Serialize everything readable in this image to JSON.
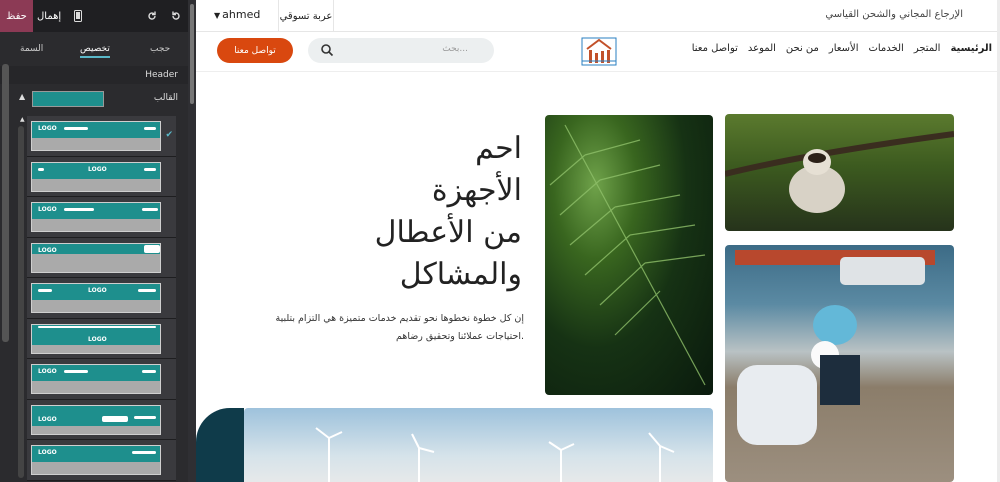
{
  "editor": {
    "save_label": "حفظ",
    "discard_label": "إهمال",
    "tabs": {
      "theme": "السمة",
      "customize": "تخصيص",
      "hide": "حجب"
    },
    "section_title": "Header",
    "template_label": "القالب",
    "templates": [
      "LOGO",
      "LOGO",
      "LOGO",
      "LOGO",
      "LOGO",
      "LOGO",
      "LOGO",
      "LOGO",
      "LOGO"
    ]
  },
  "site": {
    "promo_text": "الإرجاع المجاني والشحن القياسي",
    "user_name": "ahmed",
    "cart_label": "عربة تسوقي",
    "contact_label": "تواصل معنا",
    "search_placeholder": "بحث...",
    "menu": [
      "الرئيسية",
      "المتجر",
      "الخدمات",
      "الأسعار",
      "من نحن",
      "الموعد",
      "تواصل معنا"
    ],
    "hero_title_lines": [
      "احم",
      "الأجهزة",
      "من الأعطال",
      "والمشاكل"
    ],
    "hero_subtitle": "إن كل خطوة نخطوها نحو تقديم خدمات متميزة هي التزام بتلبية احتياجات عملائنا وتحقيق رضاهم.",
    "accent_color": "#d9480f",
    "brand_teal": "#1e8f8d"
  }
}
